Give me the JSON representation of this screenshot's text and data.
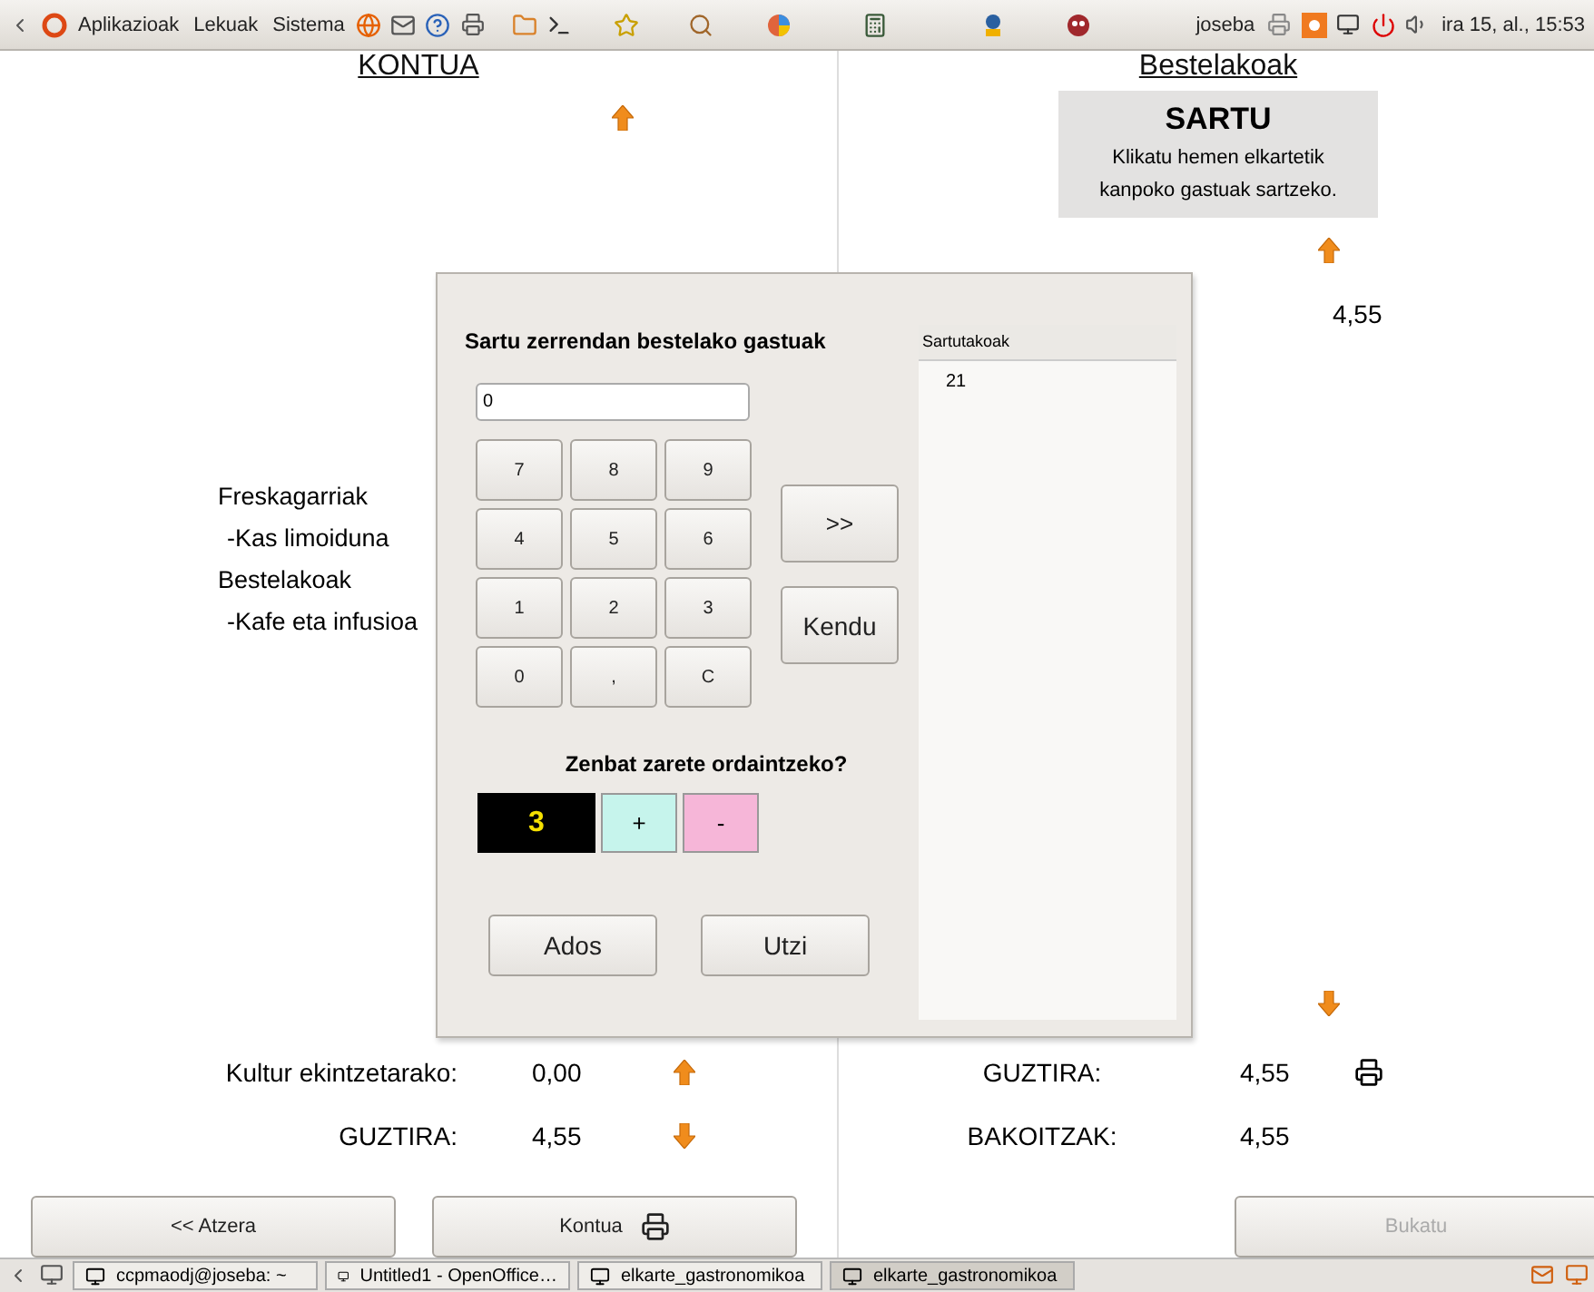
{
  "top_panel": {
    "menus": [
      "Aplikazioak",
      "Lekuak",
      "Sistema"
    ],
    "user": "joseba",
    "clock": "ira 15, al., 15:53"
  },
  "left": {
    "title": "KONTUA",
    "items": [
      {
        "text": "Freskagarriak",
        "kind": "category"
      },
      {
        "text": "-Kas limoiduna",
        "kind": "product"
      },
      {
        "text": "Bestelakoak",
        "kind": "category"
      },
      {
        "text": "-Kafe eta infusioa",
        "kind": "product"
      }
    ],
    "rows": [
      {
        "label": "Kultur ekintzetarako:",
        "value": "0,00",
        "arrow_up": true
      },
      {
        "label": "GUZTIRA:",
        "value": "4,55",
        "arrow_up": false
      }
    ],
    "buttons": [
      {
        "label": "<< Atzera",
        "printer": false
      },
      {
        "label": "Kontua",
        "printer": true
      }
    ]
  },
  "right": {
    "title": "Bestelakoak",
    "enter_box": {
      "title": "SARTU",
      "text": "Klikatu hemen elkartetik kanpoko gastuak sartzeko."
    },
    "amount": "4,55",
    "rows": [
      {
        "label": "GUZTIRA:",
        "value": "4,55",
        "printer": true
      },
      {
        "label": "BAKOITZAK:",
        "value": "4,55",
        "printer": false
      }
    ],
    "finish_button": {
      "label": "Bukatu",
      "disabled": true
    }
  },
  "dialog": {
    "title": "Sartu zerrendan bestelako gastuak",
    "input": "0",
    "keys": [
      "7",
      "8",
      "9",
      "4",
      "5",
      "6",
      "1",
      "2",
      "3",
      "0",
      ",",
      "C"
    ],
    "add_button": ">>",
    "remove_button": "Kendu",
    "question": "Zenbat zarete ordaintzeko?",
    "count": "3",
    "plus": "+",
    "minus": "-",
    "ok_button": "Ados",
    "cancel_button": "Utzi",
    "list": {
      "header": "Sartutakoak",
      "items": [
        "21"
      ]
    }
  },
  "taskbar": {
    "tasks": [
      {
        "label": "ccpmaodj@joseba: ~",
        "selected": false
      },
      {
        "label": "Untitled1 - OpenOffice…",
        "selected": false
      },
      {
        "label": "elkarte_gastronomikoa",
        "selected": false
      },
      {
        "label": "elkarte_gastronomikoa",
        "selected": true
      }
    ]
  }
}
